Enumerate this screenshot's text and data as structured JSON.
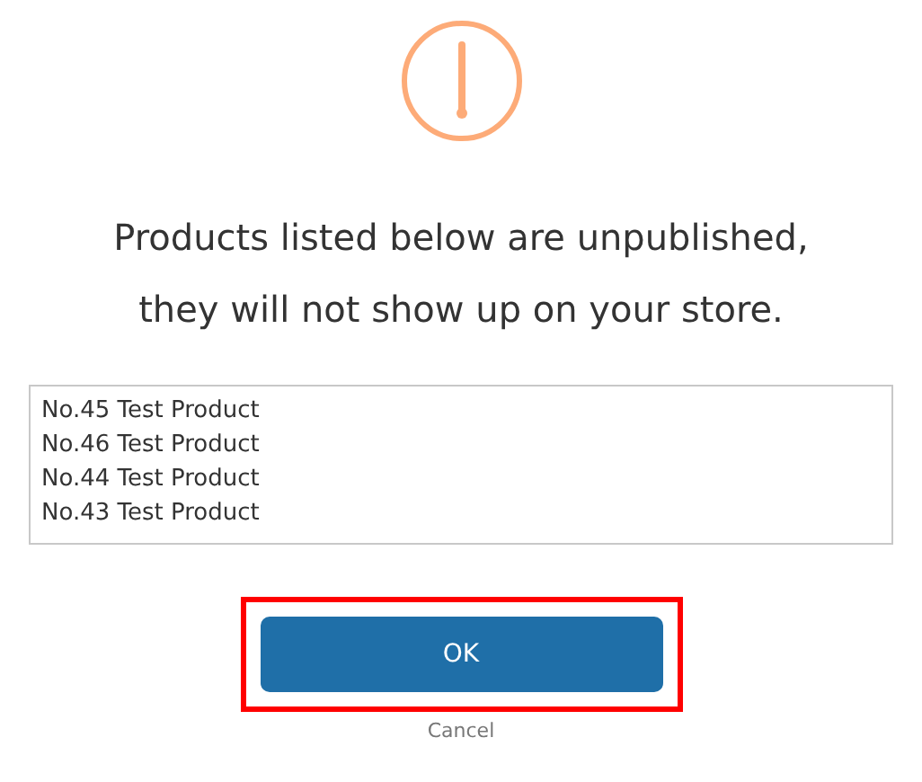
{
  "dialog": {
    "message_lines": [
      "Products listed below are unpublished,",
      "they will not show up on your store."
    ],
    "products": [
      "No.45 Test Product",
      "No.46 Test Product",
      "No.44 Test Product",
      "No.43 Test Product"
    ],
    "ok_button": {
      "label": "OK",
      "highlighted": true
    },
    "cancel_link": "Cancel"
  }
}
